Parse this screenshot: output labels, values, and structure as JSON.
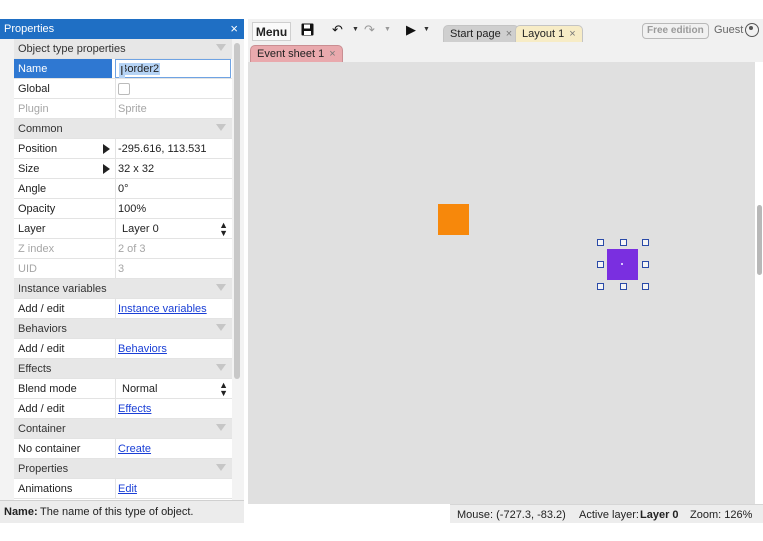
{
  "properties_panel": {
    "title": "Properties",
    "close": "×",
    "rows": [
      {
        "type": "category",
        "label": "Object type properties"
      },
      {
        "type": "name",
        "label": "Name",
        "value": "Border2"
      },
      {
        "type": "checkbox",
        "label": "Global",
        "value": ""
      },
      {
        "type": "prop",
        "label": "Plugin",
        "value": "Sprite",
        "dim": true
      },
      {
        "type": "category",
        "label": "Common"
      },
      {
        "type": "expand",
        "label": "Position",
        "value": "-295.616, 113.531"
      },
      {
        "type": "expand",
        "label": "Size",
        "value": "32 x 32"
      },
      {
        "type": "prop",
        "label": "Angle",
        "value": "0°"
      },
      {
        "type": "prop",
        "label": "Opacity",
        "value": "100%"
      },
      {
        "type": "select",
        "label": "Layer",
        "value": "Layer 0"
      },
      {
        "type": "prop",
        "label": "Z index",
        "value": "2 of 3",
        "dim": true
      },
      {
        "type": "prop",
        "label": "UID",
        "value": "3",
        "dim": true
      },
      {
        "type": "category",
        "label": "Instance variables"
      },
      {
        "type": "link",
        "label": "Add / edit",
        "value": "Instance variables"
      },
      {
        "type": "category",
        "label": "Behaviors"
      },
      {
        "type": "link",
        "label": "Add / edit",
        "value": "Behaviors"
      },
      {
        "type": "category",
        "label": "Effects"
      },
      {
        "type": "select",
        "label": "Blend mode",
        "value": "Normal"
      },
      {
        "type": "link",
        "label": "Add / edit",
        "value": "Effects"
      },
      {
        "type": "category",
        "label": "Container"
      },
      {
        "type": "link",
        "label": "No container",
        "value": "Create"
      },
      {
        "type": "category",
        "label": "Properties"
      },
      {
        "type": "link",
        "label": "Animations",
        "value": "Edit"
      }
    ],
    "help": {
      "label": "Name:",
      "text": "The name of this type of object."
    }
  },
  "toolbar": {
    "menu_label": "Menu",
    "icons": [
      "save-icon",
      "undo-icon",
      "redo-icon",
      "play-icon"
    ],
    "tabs": [
      {
        "label": "Start page",
        "close": "×"
      },
      {
        "label": "Layout 1",
        "close": "×"
      }
    ],
    "edition": "Free edition",
    "user": "Guest"
  },
  "sheet_tabs": [
    {
      "label": "Event sheet 1",
      "close": "×"
    }
  ],
  "canvas": {
    "background": "#e0e0e0",
    "objects": [
      {
        "name": "orange-sprite",
        "color": "#f7880b",
        "selected": false
      },
      {
        "name": "purple-sprite",
        "color": "#7a2fe0",
        "selected": true
      }
    ]
  },
  "statusbar": {
    "mouse": "Mouse: (-727.3, -83.2)",
    "active_layer_label": "Active layer:",
    "active_layer_value": "Layer 0",
    "zoom": "Zoom: 126%"
  },
  "colors": {
    "accent": "#1f6fc4",
    "selection": "#2f78d2",
    "layout_tab": "#f7ecc6",
    "event_tab": "#e9a9ad"
  }
}
